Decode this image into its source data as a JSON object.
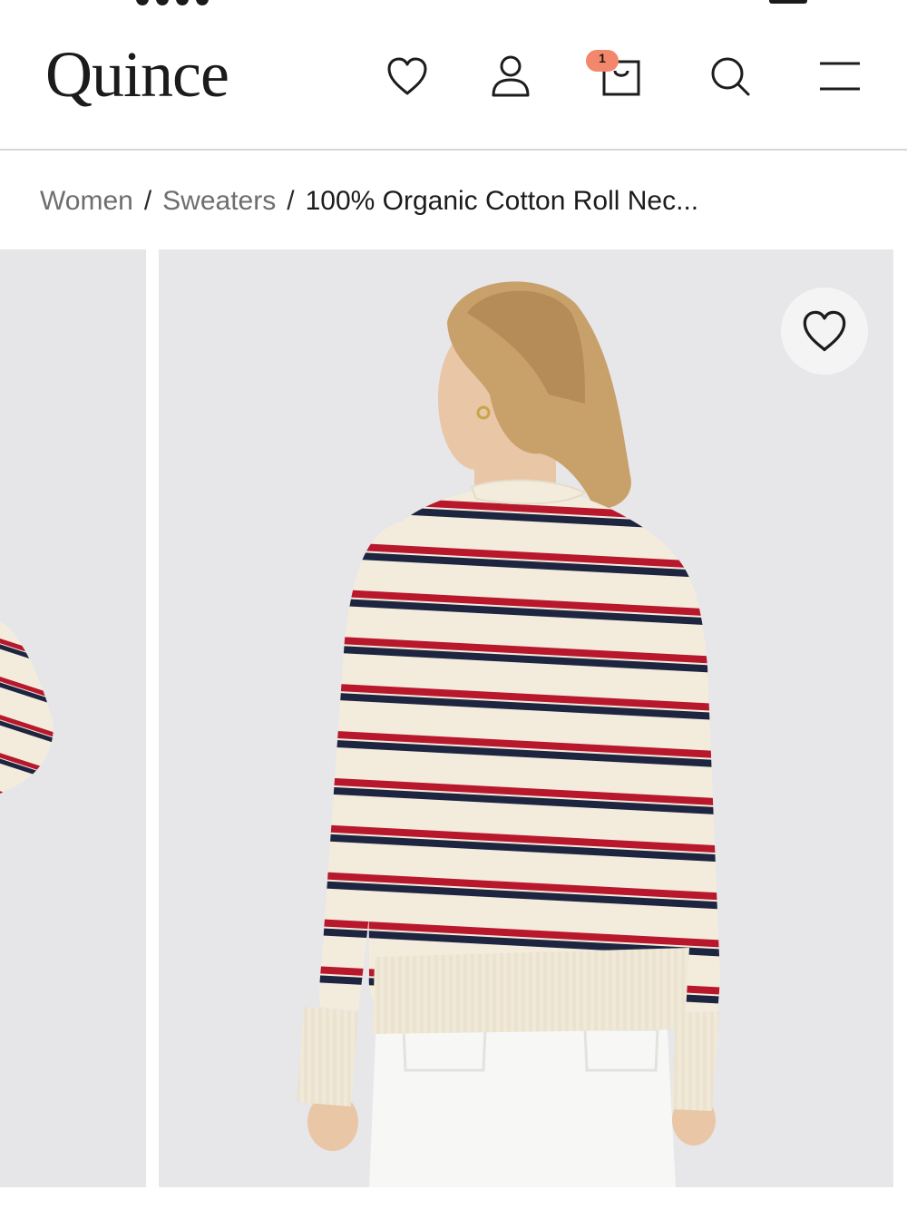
{
  "header": {
    "logo_text": "Quince",
    "cart_count": "1",
    "icons": [
      "heart-icon",
      "account-icon",
      "shopping-bag-icon",
      "search-icon",
      "menu-icon"
    ]
  },
  "breadcrumb": {
    "items": [
      "Women",
      "Sweaters"
    ],
    "current": "100% Organic Cotton Roll Nec..."
  },
  "gallery": {
    "favorite_icon": "heart-icon",
    "colors": {
      "background": "#e7e6e9",
      "sweater_cream": "#f3ecdd",
      "stripe_red": "#b8172c",
      "stripe_navy": "#1e2540",
      "hair": "#c8a06a",
      "skin": "#e9c6a6"
    }
  },
  "colors": {
    "badge": "#f2876b",
    "divider": "#d7d7d7",
    "breadcrumb_link": "#6e6e6e"
  }
}
